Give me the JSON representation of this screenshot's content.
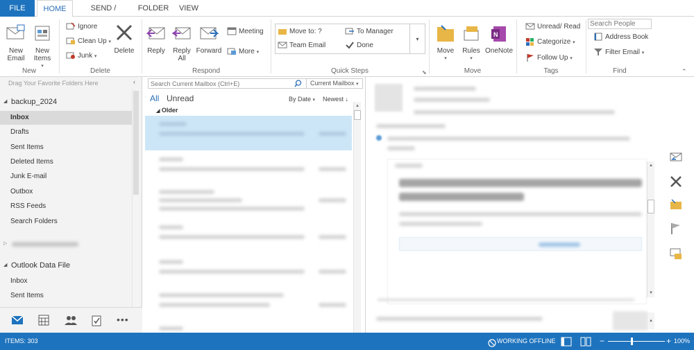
{
  "tabs": [
    "FILE",
    "HOME",
    "SEND / RECEIVE",
    "FOLDER",
    "VIEW"
  ],
  "ribbon": {
    "new": {
      "new_email": "New\nEmail",
      "new_items": "New\nItems",
      "label": "New"
    },
    "delete": {
      "ignore": "Ignore",
      "clean_up": "Clean Up",
      "junk": "Junk",
      "delete": "Delete",
      "label": "Delete"
    },
    "respond": {
      "reply": "Reply",
      "reply_all": "Reply\nAll",
      "forward": "Forward",
      "meeting": "Meeting",
      "more": "More",
      "label": "Respond"
    },
    "quick_steps": {
      "move_to": "Move to: ?",
      "to_manager": "To Manager",
      "team_email": "Team Email",
      "done": "Done",
      "label": "Quick Steps"
    },
    "move": {
      "move": "Move",
      "rules": "Rules",
      "onenote": "OneNote",
      "label": "Move"
    },
    "tags": {
      "unread_read": "Unread/ Read",
      "categorize": "Categorize",
      "follow_up": "Follow Up",
      "label": "Tags"
    },
    "find": {
      "search_people_placeholder": "Search People",
      "address_book": "Address Book",
      "filter_email": "Filter Email",
      "label": "Find"
    }
  },
  "nav": {
    "favorites_hint": "Drag Your Favorite Folders Here",
    "account": "backup_2024",
    "folders": [
      "Inbox",
      "Drafts",
      "Sent Items",
      "Deleted Items",
      "Junk E-mail",
      "Outbox",
      "RSS Feeds",
      "Search Folders"
    ],
    "data_file": "Outlook Data File",
    "data_file_folders": [
      "Inbox",
      "Sent Items"
    ]
  },
  "list": {
    "search_placeholder": "Search Current Mailbox (Ctrl+E)",
    "scope": "Current Mailbox",
    "filter_all": "All",
    "filter_unread": "Unread",
    "sort_by": "By Date",
    "sort_order": "Newest",
    "group_older": "Older"
  },
  "status": {
    "items": "ITEMS: 303",
    "offline": "WORKING OFFLINE",
    "zoom": "100%"
  },
  "colors": {
    "accent": "#1e73be",
    "selected_row": "#cde6f7"
  }
}
